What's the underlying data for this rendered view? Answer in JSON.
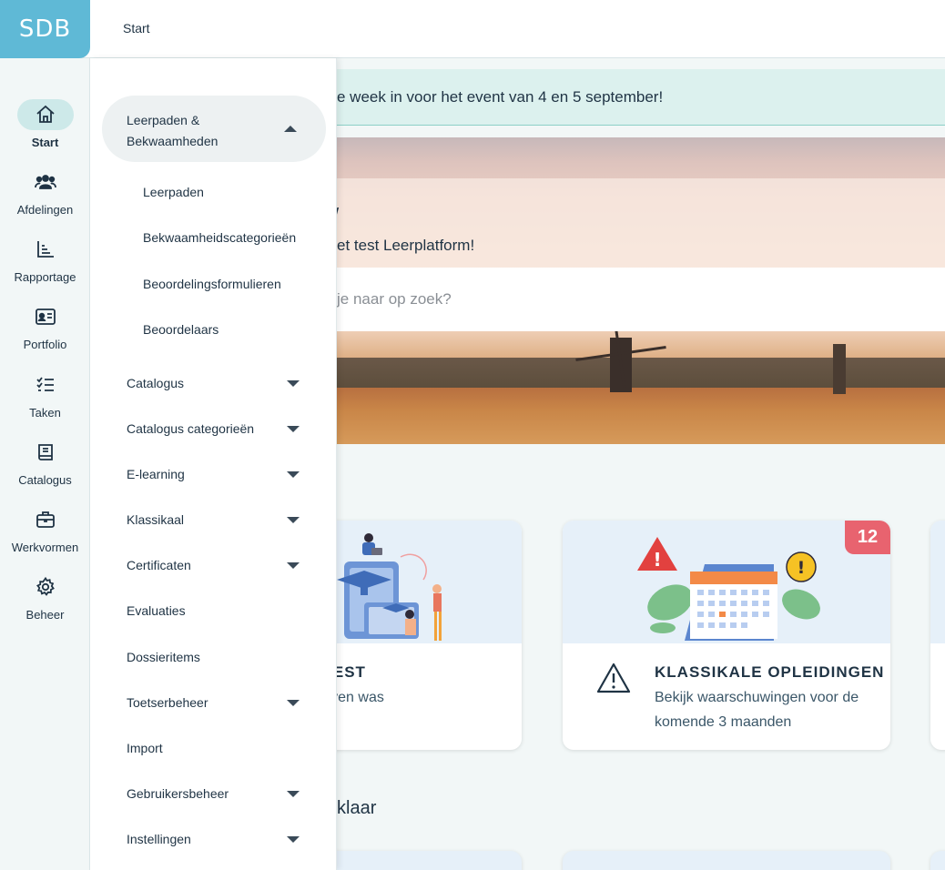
{
  "app": {
    "logo_text": "SDB",
    "breadcrumb": "Start"
  },
  "rail": [
    {
      "id": "start",
      "label": "Start",
      "icon": "home-icon",
      "active": true
    },
    {
      "id": "afdelingen",
      "label": "Afdelingen",
      "icon": "users-icon"
    },
    {
      "id": "rapportage",
      "label": "Rapportage",
      "icon": "chart-icon"
    },
    {
      "id": "portfolio",
      "label": "Portfolio",
      "icon": "id-card-icon"
    },
    {
      "id": "taken",
      "label": "Taken",
      "icon": "checklist-icon"
    },
    {
      "id": "catalogus",
      "label": "Catalogus",
      "icon": "book-icon"
    },
    {
      "id": "werkvormen",
      "label": "Werkvormen",
      "icon": "briefcase-icon"
    },
    {
      "id": "beheer",
      "label": "Beheer",
      "icon": "gear-icon"
    }
  ],
  "menu": {
    "open_group": "Leerpaden & Bekwaamheden",
    "open_items": [
      "Leerpaden",
      "Bekwaamheidscategorieën",
      "Beoordelingsformulieren",
      "Beoordelaars"
    ],
    "items": [
      {
        "label": "Catalogus",
        "expandable": true
      },
      {
        "label": "Catalogus categorieën",
        "expandable": true
      },
      {
        "label": "E-learning",
        "expandable": true
      },
      {
        "label": "Klassikaal",
        "expandable": true
      },
      {
        "label": "Certificaten",
        "expandable": true
      },
      {
        "label": "Evaluaties",
        "expandable": false
      },
      {
        "label": "Dossieritems",
        "expandable": false
      },
      {
        "label": "Toetserbeheer",
        "expandable": true
      },
      {
        "label": "Import",
        "expandable": false
      },
      {
        "label": "Gebruikersbeheer",
        "expandable": true
      },
      {
        "label": "Instellingen",
        "expandable": true
      }
    ]
  },
  "banner": {
    "text": "e week in voor het event van 4 en 5 september!"
  },
  "hero": {
    "heading": "/",
    "subtitle": "et test Leerplatform!",
    "search_placeholder": "je naar op zoek?"
  },
  "cards": [
    {
      "title": "C | TEST",
      "desc": "gebleven was"
    },
    {
      "title": "KLASSIKALE OPLEIDINGEN",
      "desc": "Bekijk waarschuwingen voor de komende 3 maanden",
      "badge": "12"
    }
  ],
  "section2": {
    "title": "klaar"
  },
  "colors": {
    "accent": "#5fb9d6",
    "badge": "#e8636f",
    "active_pill": "#cde9e9"
  }
}
